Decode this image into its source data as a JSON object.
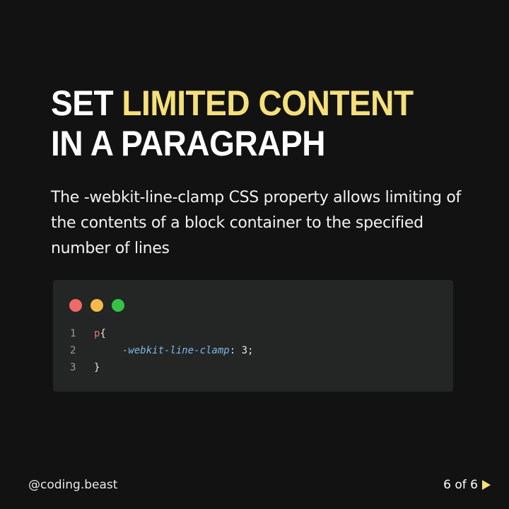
{
  "title": {
    "part1": "SET ",
    "highlight": "LIMITED CONTENT",
    "line2": "IN A PARAGRAPH"
  },
  "description": "The -webkit-line-clamp CSS property allows limiting of the contents of a block container to the specified number of lines",
  "code": {
    "line_numbers": [
      "1",
      "2",
      "3"
    ],
    "selector": "p",
    "open_brace": "{",
    "property": "-webkit-line-clamp",
    "colon": ": ",
    "value": "3",
    "semicolon": ";",
    "close_brace": "}"
  },
  "footer": {
    "handle": "@coding.beast",
    "pager": "6 of 6"
  },
  "colors": {
    "background": "#121212",
    "highlight": "#f5e07a",
    "code_bg": "#232624",
    "dot_red": "#f06a6a",
    "dot_yellow": "#f7b94a",
    "dot_green": "#36c249"
  },
  "icons": {
    "next": "play-triangle-icon"
  }
}
